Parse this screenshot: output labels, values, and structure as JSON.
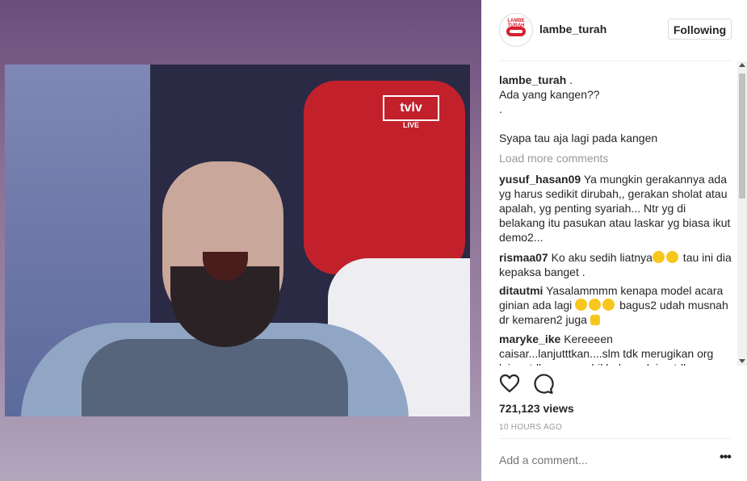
{
  "post": {
    "username": "lambe_turah",
    "follow_label": "Following",
    "avatar_text": "LAMBE TURAH"
  },
  "video": {
    "tv_logo": "tvlv",
    "tv_live": "LIVE"
  },
  "caption": {
    "username": "lambe_turah",
    "suffix": ".",
    "line1": "Ada yang kangen??",
    "line2": ".",
    "line3": "Syapa tau aja lagi pada kangen"
  },
  "load_more": "Load more comments",
  "comments": [
    {
      "user": "yusuf_hasan09",
      "text": "Ya mungkin gerakannya ada yg harus sedikit dirubah,, gerakan sholat atau apalah, yg penting syariah... Ntr yg di belakang itu pasukan atau laskar yg biasa ikut demo2..."
    },
    {
      "user": "rismaa07",
      "text_a": "Ko aku sedih liatnya",
      "text_b": " tau ini dia kepaksa banget ."
    },
    {
      "user": "ditautmi",
      "text_a": "Yasalammmm kenapa model acara ginian ada lagi",
      "text_b": " bagus2 udah musnah dr kemaren2 juga"
    },
    {
      "user": "maryke_ike",
      "text": "Kereeeen caisar...lanjutttkan....slm tdk merugikan org lain....tdk mengambil hak org lain...tdk"
    }
  ],
  "stats": {
    "views": "721,123 views",
    "time": "10 HOURS AGO"
  },
  "add_comment_placeholder": "Add a comment...",
  "more_label": "•••"
}
